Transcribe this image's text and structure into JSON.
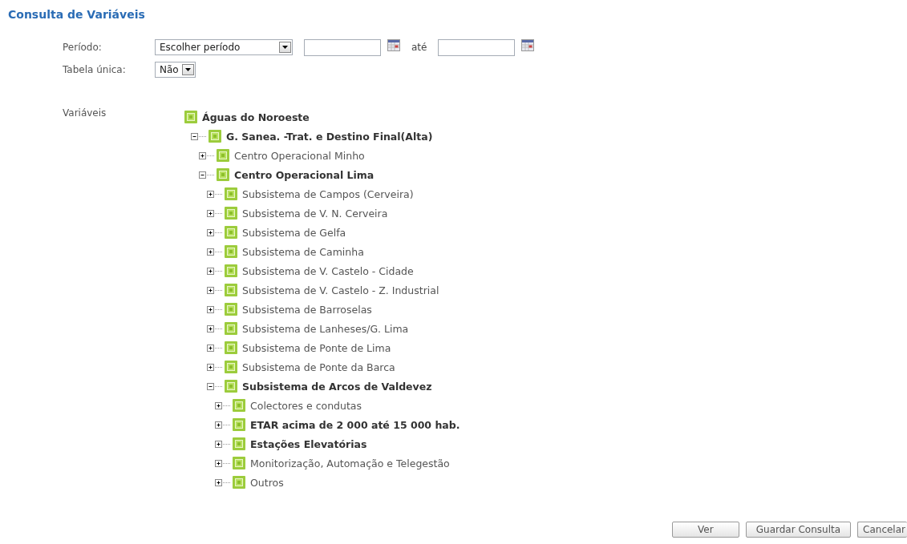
{
  "title": "Consulta de Variáveis",
  "form": {
    "period_label": "Período:",
    "period_select": "Escolher período",
    "to_label": "até",
    "single_table_label": "Tabela única:",
    "single_table_select": "Não"
  },
  "variables_label": "Variáveis",
  "tree": [
    {
      "label": "Águas do Noroeste",
      "kind": "root",
      "bold": true,
      "expanded": true,
      "children": [
        {
          "label": "G. Sanea. -Trat. e Destino Final(Alta)",
          "kind": "node",
          "bold": true,
          "expanded": true,
          "children": [
            {
              "label": "Centro Operacional Minho",
              "kind": "node",
              "bold": false,
              "expanded": false
            },
            {
              "label": "Centro Operacional Lima",
              "kind": "node",
              "bold": true,
              "expanded": true,
              "children": [
                {
                  "label": "Subsistema de Campos (Cerveira)",
                  "kind": "node",
                  "bold": false,
                  "expanded": false
                },
                {
                  "label": "Subsistema de V. N. Cerveira",
                  "kind": "node",
                  "bold": false,
                  "expanded": false
                },
                {
                  "label": "Subsistema de Gelfa",
                  "kind": "node",
                  "bold": false,
                  "expanded": false
                },
                {
                  "label": "Subsistema de Caminha",
                  "kind": "node",
                  "bold": false,
                  "expanded": false
                },
                {
                  "label": "Subsistema de V. Castelo - Cidade",
                  "kind": "node",
                  "bold": false,
                  "expanded": false
                },
                {
                  "label": "Subsistema de V. Castelo - Z. Industrial",
                  "kind": "node",
                  "bold": false,
                  "expanded": false
                },
                {
                  "label": "Subsistema de Barroselas",
                  "kind": "node",
                  "bold": false,
                  "expanded": false
                },
                {
                  "label": "Subsistema de Lanheses/G. Lima",
                  "kind": "node",
                  "bold": false,
                  "expanded": false
                },
                {
                  "label": "Subsistema de Ponte de Lima",
                  "kind": "node",
                  "bold": false,
                  "expanded": false
                },
                {
                  "label": "Subsistema de Ponte da Barca",
                  "kind": "node",
                  "bold": false,
                  "expanded": false
                },
                {
                  "label": "Subsistema de Arcos de Valdevez",
                  "kind": "node",
                  "bold": true,
                  "expanded": true,
                  "children": [
                    {
                      "label": "Colectores e condutas",
                      "kind": "node",
                      "bold": false,
                      "expanded": false
                    },
                    {
                      "label": "ETAR acima de 2 000 até 15 000 hab.",
                      "kind": "node",
                      "bold": true,
                      "expanded": false
                    },
                    {
                      "label": "Estações Elevatórias",
                      "kind": "node",
                      "bold": true,
                      "expanded": false
                    },
                    {
                      "label": "Monitorização, Automação e Telegestão",
                      "kind": "node",
                      "bold": false,
                      "expanded": false
                    },
                    {
                      "label": "Outros",
                      "kind": "node",
                      "bold": false,
                      "expanded": false
                    }
                  ]
                }
              ]
            }
          ]
        }
      ]
    }
  ],
  "buttons": [
    "Ver",
    "Guardar Consulta",
    "Cancelar"
  ]
}
